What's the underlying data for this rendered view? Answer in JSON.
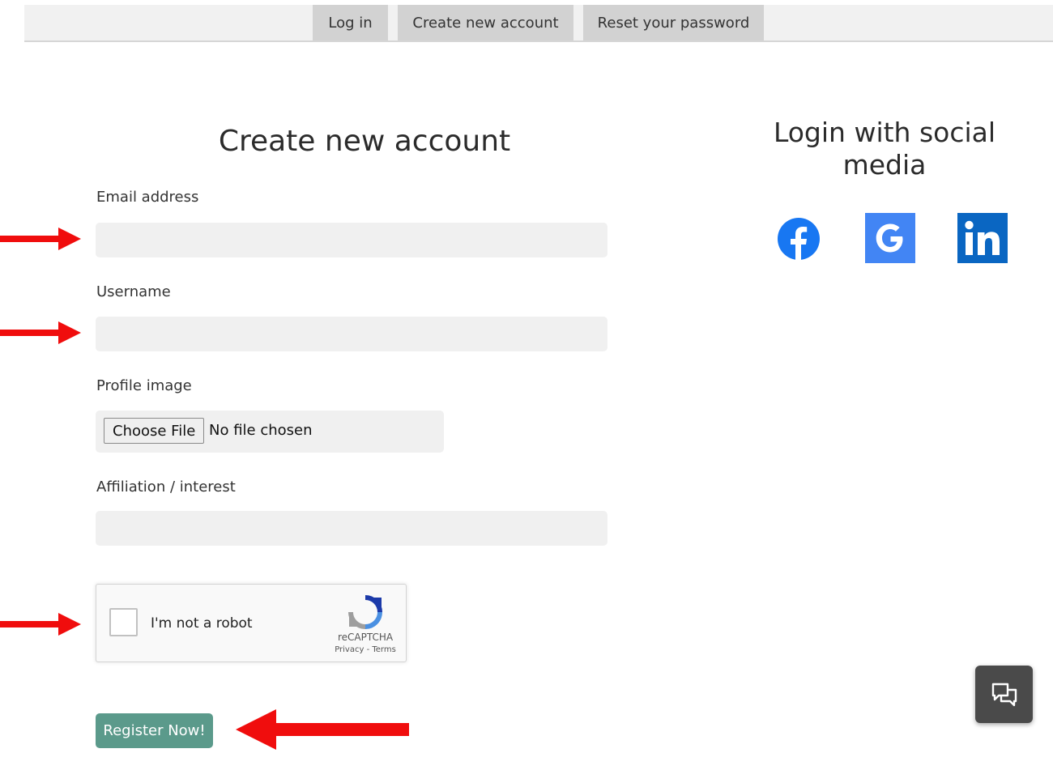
{
  "nav": {
    "tabs": [
      {
        "label": "Log in"
      },
      {
        "label": "Create new account"
      },
      {
        "label": "Reset your password"
      }
    ]
  },
  "form": {
    "title": "Create new account",
    "email": {
      "label": "Email address",
      "value": "",
      "placeholder": ""
    },
    "username": {
      "label": "Username",
      "value": "",
      "placeholder": ""
    },
    "profile_image": {
      "label": "Profile image",
      "button_label": "Choose File",
      "status": "No file chosen"
    },
    "affiliation": {
      "label": "Affiliation / interest",
      "value": "",
      "placeholder": ""
    },
    "recaptcha": {
      "label": "I'm not a robot",
      "brand": "reCAPTCHA",
      "links": "Privacy - Terms"
    },
    "submit_label": "Register Now!"
  },
  "social": {
    "title": "Login with social media",
    "providers": [
      {
        "icon": "facebook-icon",
        "color": "#1877f2"
      },
      {
        "icon": "google-icon",
        "color": "#4285f4"
      },
      {
        "icon": "linkedin-icon",
        "color": "#0a66c2"
      }
    ]
  },
  "colors": {
    "accent": "#5b9a8b",
    "annotation_arrow": "#f00d0d",
    "field_bg": "#f0f0f0",
    "chat_button": "#4a4a4a"
  },
  "icons": {
    "chat": "chat-bubbles-icon"
  }
}
